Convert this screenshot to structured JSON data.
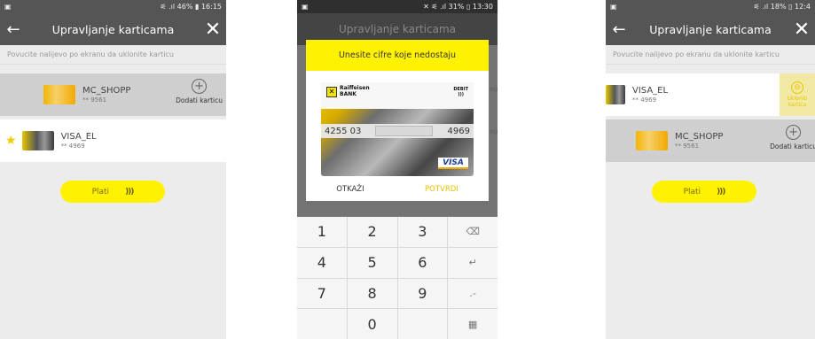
{
  "phone1": {
    "status": {
      "left_icon": "▣",
      "right": "⚟ .ıl 46% ▮ 16:15"
    },
    "appbar": {
      "back": "←",
      "title": "Upravljanje karticama",
      "tools": "✕"
    },
    "hint": "Povucite nalijevo po ekranu da uklonite karticu",
    "cards": [
      {
        "name": "MC_SHOPP",
        "number": "** 9561",
        "add_label": "Dodati karticu",
        "add_symbol": "+"
      },
      {
        "name": "VISA_EL",
        "number": "** 4969",
        "star": "★"
      }
    ],
    "pay": {
      "label": "Plati",
      "nfc": ")))"
    }
  },
  "phone2": {
    "status": {
      "left_icon": "▣",
      "right": "✕ ⚟ .ıl 31% ▯ 13:30"
    },
    "dialog": {
      "title": "Unesite cifre koje nedostaju",
      "card": {
        "bank_top": "Raiffeisen",
        "bank_bottom": "BANK",
        "debit": "DEBIT",
        "number_left": "4255 03",
        "number_right": "4969",
        "visa": "VISA"
      },
      "cancel": "OTKAŽI",
      "confirm": "POTVRDI"
    },
    "behind": {
      "title": "Upravljanje karticama",
      "side1": "cu",
      "side2": "cu"
    },
    "keypad": [
      "1",
      "2",
      "3",
      "⌫",
      "4",
      "5",
      "6",
      "↵",
      "7",
      "8",
      "9",
      ".-",
      "",
      "0",
      "",
      "▦"
    ]
  },
  "phone3": {
    "status": {
      "left_icon": "▣",
      "right": "⚟ .ıl 18% ▯ 12:4"
    },
    "appbar": {
      "back": "←",
      "title": "Upravljanje karticama",
      "tools": "✕"
    },
    "hint": "Povucite nalijevo po ekranu da uklonite karticu",
    "cards": [
      {
        "name": "VISA_EL",
        "number": "** 4969",
        "swipe_label": "Ukloniti karticu",
        "swipe_symbol": "⊖"
      },
      {
        "name": "MC_SHOPP",
        "number": "** 9561",
        "add_label": "Dodati karticu",
        "add_symbol": "+"
      }
    ],
    "pay": {
      "label": "Plati",
      "nfc": ")))"
    }
  }
}
